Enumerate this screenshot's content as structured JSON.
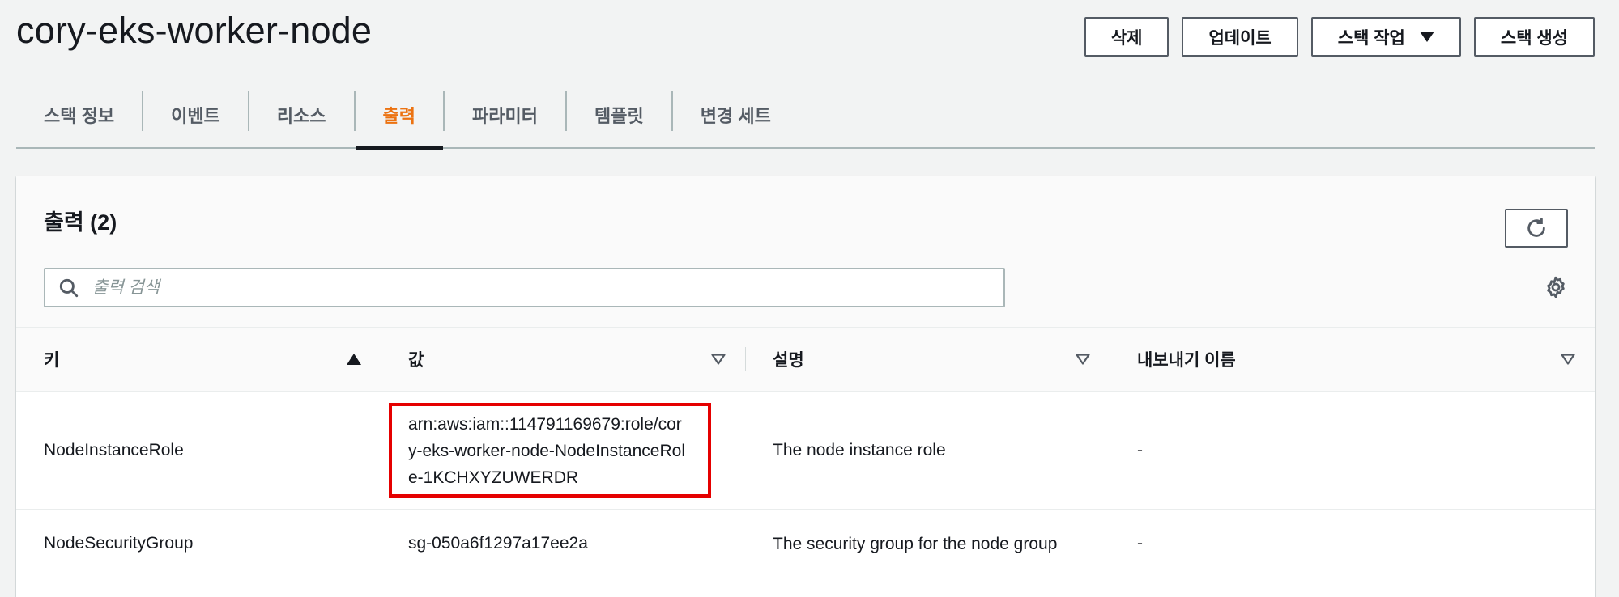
{
  "page": {
    "title": "cory-eks-worker-node"
  },
  "actions": {
    "delete": "삭제",
    "update": "업데이트",
    "stack_actions": "스택 작업",
    "create_stack": "스택 생성"
  },
  "tabs": [
    {
      "label": "스택 정보"
    },
    {
      "label": "이벤트"
    },
    {
      "label": "리소스"
    },
    {
      "label": "출력",
      "active": true
    },
    {
      "label": "파라미터"
    },
    {
      "label": "템플릿"
    },
    {
      "label": "변경 세트"
    }
  ],
  "outputs": {
    "title": "출력 (2)",
    "search_placeholder": "출력 검색",
    "columns": {
      "key": "키",
      "value": "값",
      "description": "설명",
      "export_name": "내보내기 이름"
    },
    "rows": [
      {
        "key": "NodeInstanceRole",
        "value": "arn:aws:iam::114791169679:role/cory-eks-worker-node-NodeInstanceRole-1KCHXYZUWERDR",
        "description": "The node instance role",
        "export_name": "-"
      },
      {
        "key": "NodeSecurityGroup",
        "value": "sg-050a6f1297a17ee2a",
        "description": "The security group for the node group",
        "export_name": "-"
      }
    ]
  },
  "colors": {
    "accent": "#ec7211",
    "highlight_border": "#e50000"
  }
}
